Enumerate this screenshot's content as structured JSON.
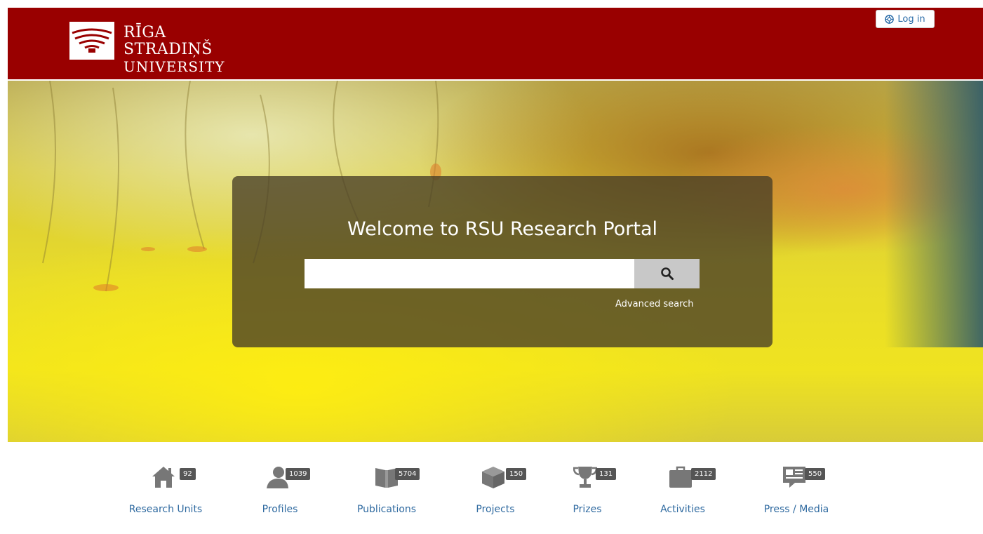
{
  "header": {
    "logo_line1": "RĪGA STRADIŅŠ",
    "logo_line2": "UNIVERSITY",
    "login_label": "Log in",
    "brand_color": "#990000"
  },
  "hero": {
    "welcome": "Welcome to RSU Research Portal",
    "search_placeholder": "",
    "advanced_search": "Advanced search"
  },
  "nav": {
    "items": [
      {
        "label": "Research Units",
        "count": "92",
        "icon": "house-icon"
      },
      {
        "label": "Profiles",
        "count": "1039",
        "icon": "person-icon"
      },
      {
        "label": "Publications",
        "count": "5704",
        "icon": "book-icon"
      },
      {
        "label": "Projects",
        "count": "150",
        "icon": "box-icon"
      },
      {
        "label": "Prizes",
        "count": "131",
        "icon": "trophy-icon"
      },
      {
        "label": "Activities",
        "count": "2112",
        "icon": "briefcase-icon"
      },
      {
        "label": "Press / Media",
        "count": "550",
        "icon": "newspaper-icon"
      }
    ]
  }
}
